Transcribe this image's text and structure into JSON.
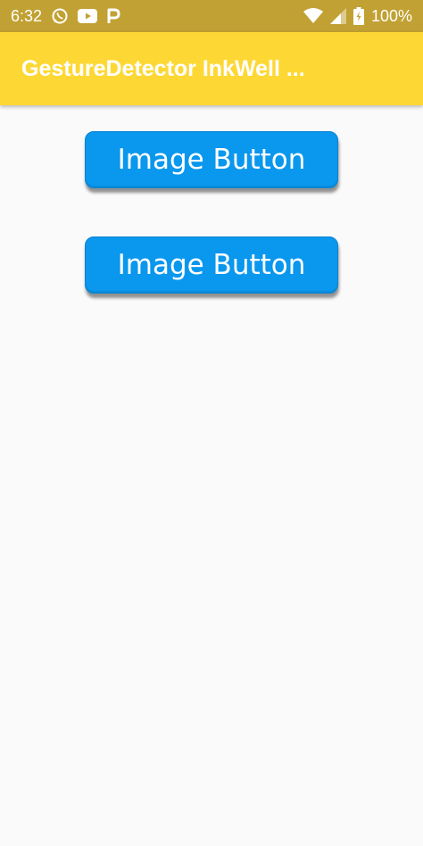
{
  "status_bar": {
    "time": "6:32",
    "battery_percent": "100%",
    "left_icons": [
      "whatsapp-icon",
      "youtube-icon",
      "parking-icon"
    ],
    "right_icons": [
      "wifi-icon",
      "cell-signal-icon",
      "battery-icon"
    ]
  },
  "app_bar": {
    "title": "GestureDetector InkWell ...",
    "background_color": "#fdd835"
  },
  "buttons": [
    {
      "label": "Image Button",
      "color": "#0a97ee"
    },
    {
      "label": "Image Button",
      "color": "#0a97ee"
    }
  ]
}
